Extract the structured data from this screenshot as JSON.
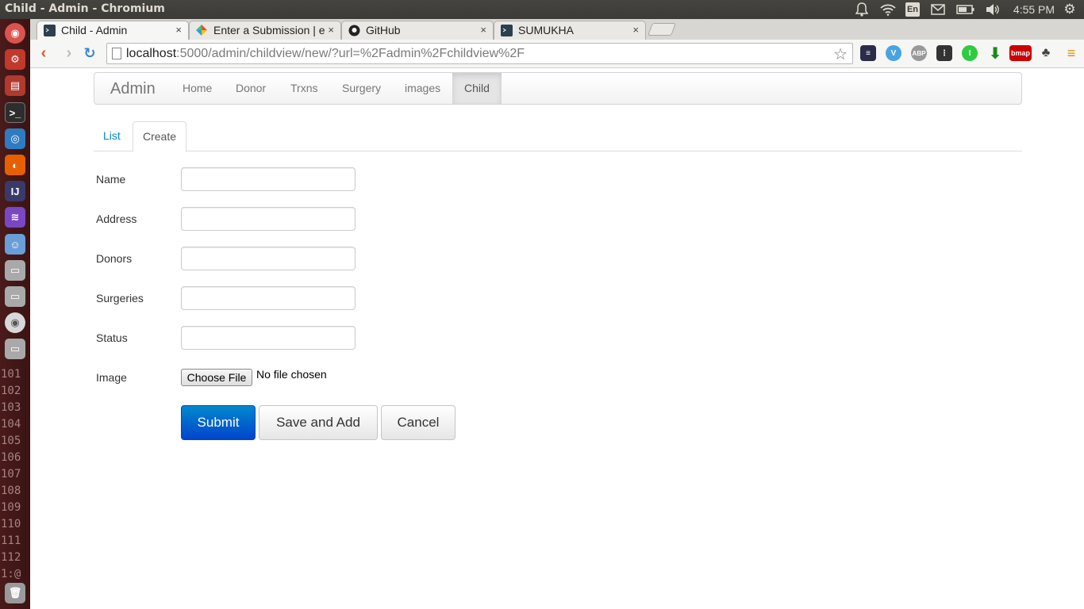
{
  "system": {
    "window_title": "Child - Admin - Chromium",
    "clock": "4:55 PM",
    "keyboard_layout": "En"
  },
  "launcher": {
    "line_numbers": [
      "101",
      "102",
      "103",
      "104",
      "105",
      "106",
      "107",
      "108",
      "109",
      "110",
      "111",
      "112"
    ],
    "terminal_tail": "1:@"
  },
  "browser": {
    "tabs": [
      {
        "label": "Child - Admin",
        "icon": "terminal-favicon-icon",
        "active": true
      },
      {
        "label": "Enter a Submission | e",
        "icon": "pinwheel-favicon-icon",
        "active": false
      },
      {
        "label": "GitHub",
        "icon": "github-favicon-icon",
        "active": false
      },
      {
        "label": "SUMUKHA",
        "icon": "terminal-favicon-icon",
        "active": false
      }
    ],
    "close_symbol": "×",
    "url_host": "localhost",
    "url_rest": ":5000/admin/childview/new/?url=%2Fadmin%2Fchildview%2F",
    "extensions": [
      "buffer-icon",
      "vimeo-icon",
      "adblock-icon",
      "traffic-light-icon",
      "instapaper-icon",
      "download-icon",
      "bmap-icon",
      "evernote-icon"
    ],
    "bmap_label": "bmap",
    "abp_label": "ABP"
  },
  "navbar": {
    "brand": "Admin",
    "items": [
      "Home",
      "Donor",
      "Trxns",
      "Surgery",
      "images",
      "Child"
    ],
    "active_item": "Child"
  },
  "tabs": {
    "list_label": "List",
    "create_label": "Create"
  },
  "form": {
    "fields": [
      {
        "label": "Name",
        "value": ""
      },
      {
        "label": "Address",
        "value": ""
      },
      {
        "label": "Donors",
        "value": ""
      },
      {
        "label": "Surgeries",
        "value": ""
      },
      {
        "label": "Status",
        "value": ""
      }
    ],
    "image_label": "Image",
    "choose_file_label": "Choose File",
    "no_file_text": "No file chosen",
    "submit_label": "Submit",
    "save_add_label": "Save and Add",
    "cancel_label": "Cancel"
  },
  "colors": {
    "primary": "#0088cc",
    "primary_dark": "#0044cc",
    "link": "#0088cc",
    "launcher": "#4a1b1b"
  }
}
